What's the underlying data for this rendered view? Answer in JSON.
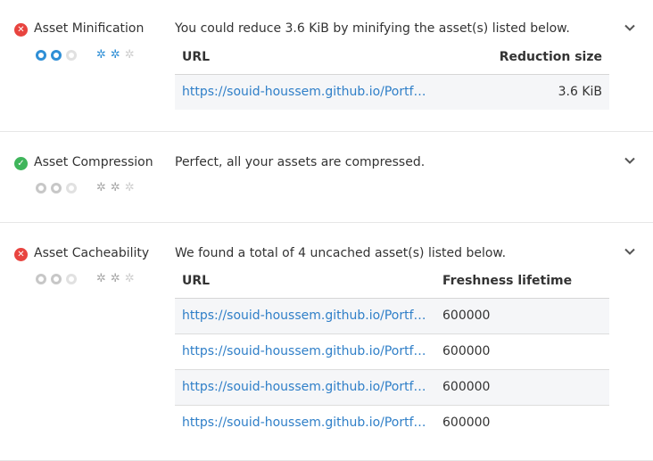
{
  "sections": [
    {
      "status": "fail",
      "title": "Asset Minification",
      "description": "You could reduce 3.6 KiB by minifying the asset(s) listed below.",
      "columns": [
        "URL",
        "Reduction size"
      ],
      "rows": [
        {
          "url": "https://souid-houssem.github.io/Portfol...",
          "value": "3.6 KiB"
        }
      ]
    },
    {
      "status": "pass",
      "title": "Asset Compression",
      "description": "Perfect, all your assets are compressed."
    },
    {
      "status": "fail",
      "title": "Asset Cacheability",
      "description": "We found a total of 4 uncached asset(s) listed below.",
      "columns": [
        "URL",
        "Freshness lifetime"
      ],
      "rows": [
        {
          "url": "https://souid-houssem.github.io/Portfol...",
          "value": "600000"
        },
        {
          "url": "https://souid-houssem.github.io/Portfol...",
          "value": "600000"
        },
        {
          "url": "https://souid-houssem.github.io/Portfol...",
          "value": "600000"
        },
        {
          "url": "https://souid-houssem.github.io/Portfol...",
          "value": "600000"
        }
      ]
    }
  ],
  "icons": {
    "fail": "x-circle-icon",
    "pass": "check-circle-icon",
    "expand": "chevron-down-icon",
    "impact": "target-icon",
    "effort": "gear-icon"
  },
  "colors": {
    "fail": "#e8443f",
    "pass": "#3fb55b",
    "accent": "#2f8fd6",
    "link": "#2f7fc8"
  }
}
